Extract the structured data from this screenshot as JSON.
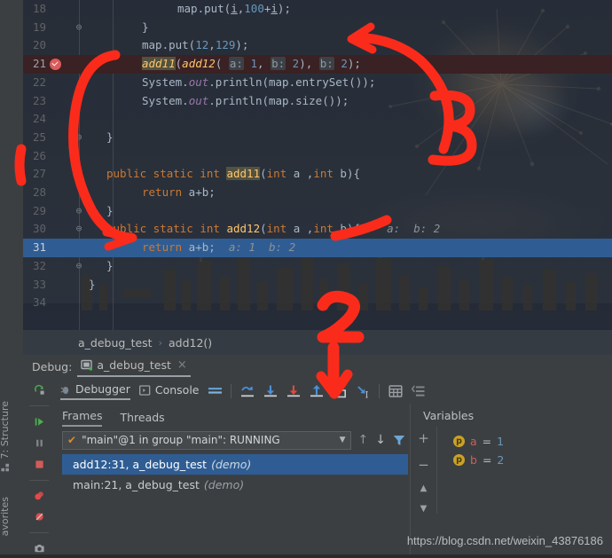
{
  "editor": {
    "lines": [
      {
        "num": "18",
        "fold": "",
        "indent": 200,
        "state": "normal",
        "tokens": [
          {
            "t": "map.put(",
            "c": "pl"
          },
          {
            "t": "i",
            "c": "undl"
          },
          {
            "t": ",",
            "c": "pl"
          },
          {
            "t": "100",
            "c": "n"
          },
          {
            "t": "+",
            "c": "pl"
          },
          {
            "t": "i",
            "c": "undl"
          },
          {
            "t": ");",
            "c": "pl"
          }
        ]
      },
      {
        "num": "19",
        "fold": "⊖",
        "indent": 160,
        "state": "normal",
        "tokens": [
          {
            "t": "}",
            "c": "pl"
          }
        ]
      },
      {
        "num": "20",
        "fold": "",
        "indent": 160,
        "state": "normal",
        "tokens": [
          {
            "t": "map.put(",
            "c": "pl"
          },
          {
            "t": "12",
            "c": "n"
          },
          {
            "t": ",",
            "c": "pl"
          },
          {
            "t": "129",
            "c": "n"
          },
          {
            "t": ");",
            "c": "pl"
          }
        ]
      },
      {
        "num": "21",
        "fold": "",
        "indent": 160,
        "state": "exec",
        "breakpoint": true,
        "tokens": [
          {
            "t": "add11",
            "c": "fn mark ital"
          },
          {
            "t": "(",
            "c": "pl"
          },
          {
            "t": "add12",
            "c": "fn ital"
          },
          {
            "t": "( ",
            "c": "pl"
          },
          {
            "t": "a:",
            "c": "hintbox"
          },
          {
            "t": " ",
            "c": "pl"
          },
          {
            "t": "1",
            "c": "n"
          },
          {
            "t": ", ",
            "c": "pl"
          },
          {
            "t": "b:",
            "c": "hintbox"
          },
          {
            "t": " ",
            "c": "pl"
          },
          {
            "t": "2",
            "c": "n"
          },
          {
            "t": "), ",
            "c": "pl"
          },
          {
            "t": "b:",
            "c": "hintbox"
          },
          {
            "t": " ",
            "c": "pl"
          },
          {
            "t": "2",
            "c": "n"
          },
          {
            "t": ");",
            "c": "pl"
          }
        ]
      },
      {
        "num": "22",
        "fold": "",
        "indent": 160,
        "state": "normal",
        "tokens": [
          {
            "t": "System.",
            "c": "pl"
          },
          {
            "t": "out",
            "c": "st"
          },
          {
            "t": ".println(map.entrySet());",
            "c": "pl"
          }
        ]
      },
      {
        "num": "23",
        "fold": "",
        "indent": 160,
        "state": "normal",
        "tokens": [
          {
            "t": "System.",
            "c": "pl"
          },
          {
            "t": "out",
            "c": "st"
          },
          {
            "t": ".println(map.size());",
            "c": "pl"
          }
        ]
      },
      {
        "num": "24",
        "fold": "",
        "indent": 160,
        "state": "normal",
        "tokens": []
      },
      {
        "num": "25",
        "fold": "⊖",
        "indent": 120,
        "state": "normal",
        "tokens": [
          {
            "t": "}",
            "c": "pl"
          }
        ]
      },
      {
        "num": "26",
        "fold": "",
        "indent": 120,
        "state": "normal",
        "tokens": []
      },
      {
        "num": "27",
        "fold": "⊖",
        "indent": 120,
        "state": "normal",
        "tokens": [
          {
            "t": "public static int ",
            "c": "k"
          },
          {
            "t": "add11",
            "c": "fn mark"
          },
          {
            "t": "(",
            "c": "pl"
          },
          {
            "t": "int",
            "c": "k"
          },
          {
            "t": " a ,",
            "c": "pl"
          },
          {
            "t": "int",
            "c": "k"
          },
          {
            "t": " b){",
            "c": "pl"
          }
        ]
      },
      {
        "num": "28",
        "fold": "",
        "indent": 160,
        "state": "normal",
        "tokens": [
          {
            "t": "return",
            "c": "k"
          },
          {
            "t": " a+b;",
            "c": "pl"
          }
        ]
      },
      {
        "num": "29",
        "fold": "⊖",
        "indent": 120,
        "state": "normal",
        "tokens": [
          {
            "t": "}",
            "c": "pl"
          }
        ]
      },
      {
        "num": "30",
        "fold": "⊖",
        "indent": 120,
        "state": "normal",
        "tokens": [
          {
            "t": "public static int ",
            "c": "k"
          },
          {
            "t": "add12",
            "c": "fn"
          },
          {
            "t": "(",
            "c": "pl"
          },
          {
            "t": "int",
            "c": "k"
          },
          {
            "t": " a ,",
            "c": "pl"
          },
          {
            "t": "int",
            "c": "k"
          },
          {
            "t": " b){",
            "c": "pl"
          },
          {
            "t": "    a:  b: 2",
            "c": "vhint"
          }
        ]
      },
      {
        "num": "31",
        "fold": "",
        "indent": 160,
        "state": "current",
        "tokens": [
          {
            "t": "return",
            "c": "k"
          },
          {
            "t": " a+b;",
            "c": "pl"
          },
          {
            "t": "  a: 1  b: 2",
            "c": "vhint"
          }
        ]
      },
      {
        "num": "32",
        "fold": "⊖",
        "indent": 120,
        "state": "normal",
        "tokens": [
          {
            "t": "}",
            "c": "pl"
          }
        ]
      },
      {
        "num": "33",
        "fold": "",
        "indent": 100,
        "state": "normal",
        "tokens": [
          {
            "t": "}",
            "c": "pl"
          }
        ]
      },
      {
        "num": "34",
        "fold": "",
        "indent": 100,
        "state": "normal",
        "tokens": []
      }
    ]
  },
  "breadcrumb": {
    "class_name": "a_debug_test",
    "separator": "›",
    "method_name": "add12()"
  },
  "debug_panel": {
    "label": "Debug:",
    "config_name": "a_debug_test",
    "close_icon": "×",
    "tabs": [
      {
        "name": "debugger-tab",
        "label": "Debugger",
        "icon": "bug-icon",
        "active": true
      },
      {
        "name": "console-tab",
        "label": "Console",
        "icon": "console-icon",
        "active": false
      }
    ],
    "toolbar_icons": [
      {
        "name": "layout-settings-icon",
        "glyph": "layout"
      },
      {
        "name": "show-execution-point-icon",
        "glyph": "exec-point"
      },
      {
        "name": "step-over-icon",
        "glyph": "step-over"
      },
      {
        "name": "step-into-icon",
        "glyph": "step-into"
      },
      {
        "name": "force-step-into-icon",
        "glyph": "force-step-into"
      },
      {
        "name": "step-out-icon",
        "glyph": "step-out"
      },
      {
        "name": "drop-frame-icon",
        "glyph": "drop-frame"
      },
      {
        "name": "run-to-cursor-icon",
        "glyph": "run-to-cursor"
      },
      {
        "name": "evaluate-expression-icon",
        "glyph": "evaluate"
      },
      {
        "name": "settings-lines-icon",
        "glyph": "lines"
      }
    ],
    "actions": [
      {
        "name": "rerun-button",
        "glyph": "rerun"
      },
      {
        "name": "resume-program-button",
        "glyph": "resume"
      },
      {
        "name": "pause-program-button",
        "glyph": "pause"
      },
      {
        "name": "stop-button",
        "glyph": "stop"
      },
      {
        "name": "view-breakpoints-button",
        "glyph": "breakpoints"
      },
      {
        "name": "mute-breakpoints-button",
        "glyph": "mute"
      },
      {
        "name": "settings-button",
        "glyph": "camera"
      }
    ],
    "frames_tabs": [
      {
        "name": "frames-tab",
        "label": "Frames",
        "active": true
      },
      {
        "name": "threads-tab",
        "label": "Threads",
        "active": false
      }
    ],
    "thread_selector": {
      "check_icon": "✔",
      "value": "\"main\"@1 in group \"main\": RUNNING",
      "caret": "▼"
    },
    "frame_nav_icons": [
      {
        "name": "frame-up-icon",
        "glyph": "↑"
      },
      {
        "name": "frame-down-icon",
        "glyph": "↓"
      },
      {
        "name": "frame-filter-icon",
        "glyph": "filter"
      }
    ],
    "frames": [
      {
        "label": "add12:31, a_debug_test",
        "qualifier": "(demo)",
        "selected": true
      },
      {
        "label": "main:21, a_debug_test",
        "qualifier": "(demo)",
        "selected": false
      }
    ],
    "variables": {
      "title": "Variables",
      "side_buttons": [
        {
          "name": "add-watch-button",
          "glyph": "+"
        },
        {
          "name": "remove-watch-button",
          "glyph": "−"
        },
        {
          "name": "move-up-button",
          "glyph": "▲"
        },
        {
          "name": "move-down-button",
          "glyph": "▼"
        }
      ],
      "rows": [
        {
          "badge": "p",
          "name": "a",
          "eq": "=",
          "value": "1"
        },
        {
          "badge": "p",
          "name": "b",
          "eq": "=",
          "value": "2"
        }
      ]
    }
  },
  "left_strip": {
    "items": [
      {
        "name": "sidebar-structure-button",
        "label": "7: Structure"
      },
      {
        "name": "sidebar-favorites-button",
        "label": "avorites"
      }
    ]
  },
  "annotations": [
    {
      "name": "annotation-1",
      "label": "",
      "kind": "arrow"
    },
    {
      "name": "annotation-2",
      "label": "2",
      "kind": "number"
    },
    {
      "name": "annotation-3",
      "label": "3",
      "kind": "number"
    }
  ],
  "watermark": {
    "text": "https://blog.csdn.net/weixin_43876186"
  }
}
